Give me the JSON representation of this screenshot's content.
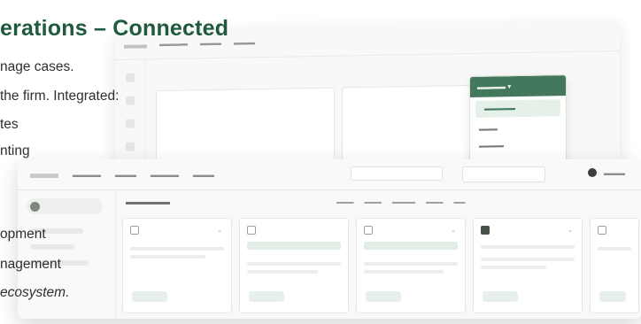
{
  "marketing": {
    "headline": "erations – Connected",
    "lines": [
      "nage cases.",
      "the firm. Integrated:",
      "tes",
      "nting",
      "opment",
      "nagement",
      "ecosystem."
    ]
  },
  "colors": {
    "brand_green": "#1e5a3b",
    "menu_green": "#2f6a4c",
    "chip_green": "#e0eee5"
  }
}
